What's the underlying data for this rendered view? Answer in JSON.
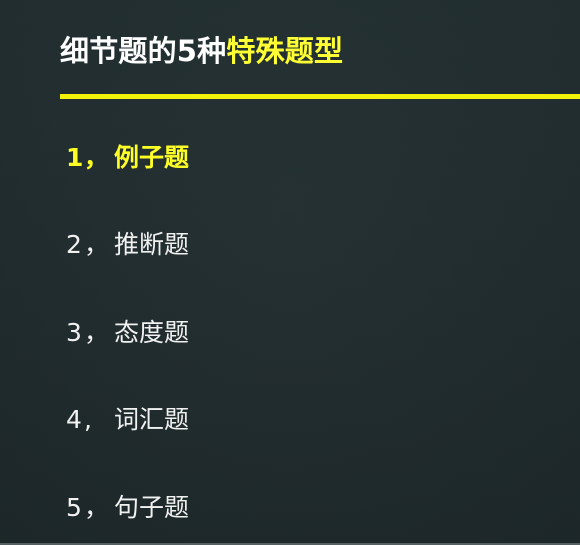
{
  "slide": {
    "title_plain": "细节题的5种",
    "title_accent": "特殊题型",
    "items": [
      {
        "number": "1",
        "separator": "，",
        "label": "例子题",
        "active": true
      },
      {
        "number": "2",
        "separator": "，",
        "label": "推断题",
        "active": false
      },
      {
        "number": "3",
        "separator": "，",
        "label": "态度题",
        "active": false
      },
      {
        "number": "4",
        "separator": ",",
        "label": "词汇题",
        "active": false
      },
      {
        "number": "5",
        "separator": "，",
        "label": "句子题",
        "active": false
      }
    ],
    "colors": {
      "background": "#1f2b2d",
      "title_text": "#ffffff",
      "accent_text": "#ffff33",
      "underline": "#f3f20b",
      "item_text": "#f1f1f1"
    }
  }
}
